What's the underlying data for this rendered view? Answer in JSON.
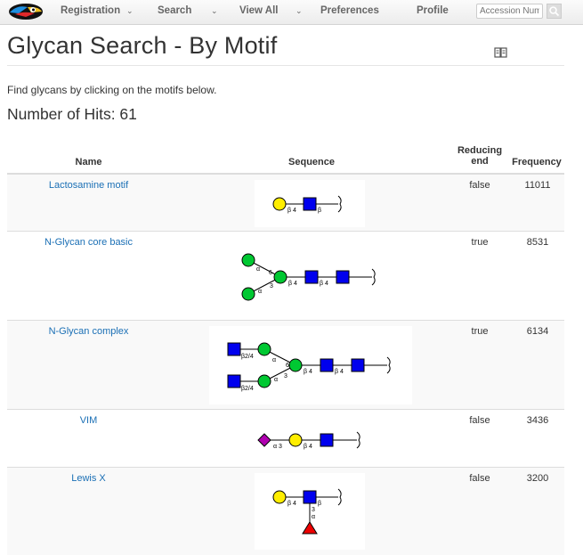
{
  "nav": {
    "items": [
      {
        "label": "Registration",
        "has_caret": true
      },
      {
        "label": "Search",
        "has_caret": true
      },
      {
        "label": "View All",
        "has_caret": true
      },
      {
        "label": "Preferences",
        "has_caret": false
      },
      {
        "label": "Profile",
        "has_caret": false
      }
    ],
    "caret_glyph": "⌄",
    "search_placeholder": "Accession Num",
    "search_icon": "magnifier-icon",
    "logo_icon": "toucan-logo-icon"
  },
  "page": {
    "title": "Glycan Search - By Motif",
    "help_icon": "book-icon",
    "intro": "Find glycans by clicking on the motifs below.",
    "hits": "Number of Hits: 61"
  },
  "table": {
    "headers": {
      "name": "Name",
      "sequence": "Sequence",
      "reducing_line1": "Reducing",
      "reducing_line2": "end",
      "frequency": "Frequency"
    },
    "rows": [
      {
        "name": "Lactosamine motif",
        "reducing_end": "false",
        "frequency": "11011"
      },
      {
        "name": "N-Glycan core basic",
        "reducing_end": "true",
        "frequency": "8531"
      },
      {
        "name": "N-Glycan complex",
        "reducing_end": "true",
        "frequency": "6134"
      },
      {
        "name": "VIM",
        "reducing_end": "false",
        "frequency": "3436"
      },
      {
        "name": "Lewis X",
        "reducing_end": "false",
        "frequency": "3200"
      }
    ]
  },
  "glycan_labels": {
    "beta": "β",
    "alpha": "α",
    "b4": "β 4",
    "b24": "β2/4",
    "n3": "3",
    "n4": "4",
    "n6": "6",
    "a3": "α 3"
  },
  "symbol_colors": {
    "galactose": "#ffee00",
    "glcnac": "#0000ee",
    "mannose": "#00c832",
    "sialic_acid": "#b000b0",
    "fucose": "#ee0000"
  }
}
